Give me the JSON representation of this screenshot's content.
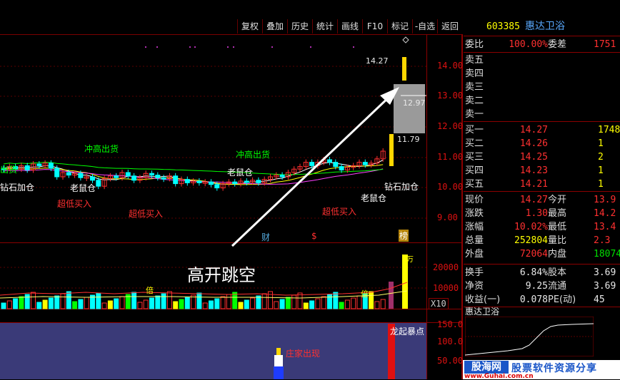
{
  "toolbar": {
    "items": [
      "复权",
      "叠加",
      "历史",
      "统计",
      "画线",
      "F10",
      "标记",
      "-自选",
      "返回"
    ]
  },
  "chart": {
    "price_ticks": [
      "14.00",
      "13.00",
      "12.00",
      "11.00",
      "10.00",
      "9.00"
    ],
    "volume_ticks": [
      "20000",
      "10000"
    ],
    "volume_unit": "X10",
    "indicator_ticks": [
      "150.0",
      "100.0",
      "50.00"
    ],
    "callouts": [
      "14.27",
      "12.97",
      "11.79"
    ],
    "markers": [
      "财",
      "$",
      "榜"
    ],
    "labels": {
      "chonggao1": "冲高出货",
      "chonggao2": "冲高出货",
      "chuhuo_left": "出货",
      "laoshucang1": "老鼠仓",
      "laoshucang2": "老鼠仓",
      "laoshucang3": "老鼠仓",
      "zuandi1": "钻石加仓",
      "zuandi2": "钻石加仓",
      "chaodi1": "超低买入",
      "chaodi2": "超低买入",
      "chaodi3": "超低买入",
      "bei1": "倍",
      "bei2": "倍",
      "wan": "万",
      "gap_text": "高开跳空",
      "longqi": "龙起暴点",
      "zhuangjia": "庄家出现"
    }
  },
  "quote": {
    "code": "603385",
    "name": "惠达卫浴",
    "weibi_label": "委比",
    "weibi": "100.00%",
    "weicha_label": "委差",
    "weicha": "1751",
    "sell": [
      {
        "label": "卖五",
        "price": "",
        "vol": ""
      },
      {
        "label": "卖四",
        "price": "",
        "vol": ""
      },
      {
        "label": "卖三",
        "price": "",
        "vol": ""
      },
      {
        "label": "卖二",
        "price": "",
        "vol": ""
      },
      {
        "label": "卖一",
        "price": "",
        "vol": ""
      }
    ],
    "buy": [
      {
        "label": "买一",
        "price": "14.27",
        "vol": "1748"
      },
      {
        "label": "买二",
        "price": "14.26",
        "vol": "1"
      },
      {
        "label": "买三",
        "price": "14.25",
        "vol": "2"
      },
      {
        "label": "买四",
        "price": "14.23",
        "vol": "1"
      },
      {
        "label": "买五",
        "price": "14.21",
        "vol": "1"
      }
    ],
    "stats": [
      {
        "l1": "现价",
        "v1": "14.27",
        "c1": "red",
        "l2": "今开",
        "v2": "13.9",
        "c2": "red"
      },
      {
        "l1": "涨跌",
        "v1": "1.30",
        "c1": "red",
        "l2": "最高",
        "v2": "14.2",
        "c2": "red"
      },
      {
        "l1": "涨幅",
        "v1": "10.02%",
        "c1": "red",
        "l2": "最低",
        "v2": "13.4",
        "c2": "red"
      },
      {
        "l1": "总量",
        "v1": "252804",
        "c1": "yel",
        "l2": "量比",
        "v2": "2.3",
        "c2": "red"
      },
      {
        "l1": "外盘",
        "v1": "72064",
        "c1": "red",
        "l2": "内盘",
        "v2": "18074",
        "c2": "grn"
      }
    ],
    "fundamentals": [
      {
        "l1": "换手",
        "v1": "6.84%",
        "l2": "股本",
        "v2": "3.69"
      },
      {
        "l1": "净资",
        "v1": "9.25",
        "l2": "流通",
        "v2": "3.69"
      },
      {
        "l1": "收益(一)",
        "v1": "0.078",
        "l2": "PE(动)",
        "v2": "45"
      }
    ],
    "mini_title": "惠达卫浴"
  },
  "logo": {
    "brand": "股海网",
    "slogan": "股票软件资源分享",
    "url": "www.Guhai.com.cn"
  },
  "colors": {
    "up": "#ff3030",
    "down": "#00ffff",
    "accent": "#ffff00",
    "grid": "#8b0000"
  }
}
